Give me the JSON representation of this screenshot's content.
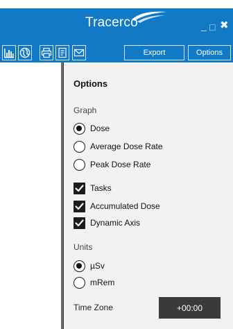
{
  "window": {
    "brand": "Tracerco",
    "minimize_glyph": "_",
    "maximize_glyph": "□",
    "close_glyph": "✖"
  },
  "toolbar": {
    "icons": [
      "bar-chart-icon",
      "globe-icon",
      "printer-icon",
      "document-icon",
      "envelope-icon"
    ],
    "export_label": "Export",
    "options_label": "Options"
  },
  "options": {
    "title": "Options",
    "graph_section": "Graph",
    "graph_modes": [
      {
        "label": "Dose",
        "selected": true
      },
      {
        "label": "Average Dose Rate",
        "selected": false
      },
      {
        "label": "Peak Dose Rate",
        "selected": false
      }
    ],
    "display_toggles": [
      {
        "label": "Tasks",
        "checked": true
      },
      {
        "label": "Accumulated Dose",
        "checked": true
      },
      {
        "label": "Dynamic Axis",
        "checked": true
      }
    ],
    "units_section": "Units",
    "units": [
      {
        "label": "µSv",
        "selected": true
      },
      {
        "label": "mRem",
        "selected": false
      }
    ],
    "time_zone_label": "Time Zone",
    "time_zone_value": "+00:00"
  },
  "colors": {
    "brand_blue": "#1279c7",
    "panel_bg": "#f2f2f2",
    "control_dark": "#1c1c1c"
  }
}
